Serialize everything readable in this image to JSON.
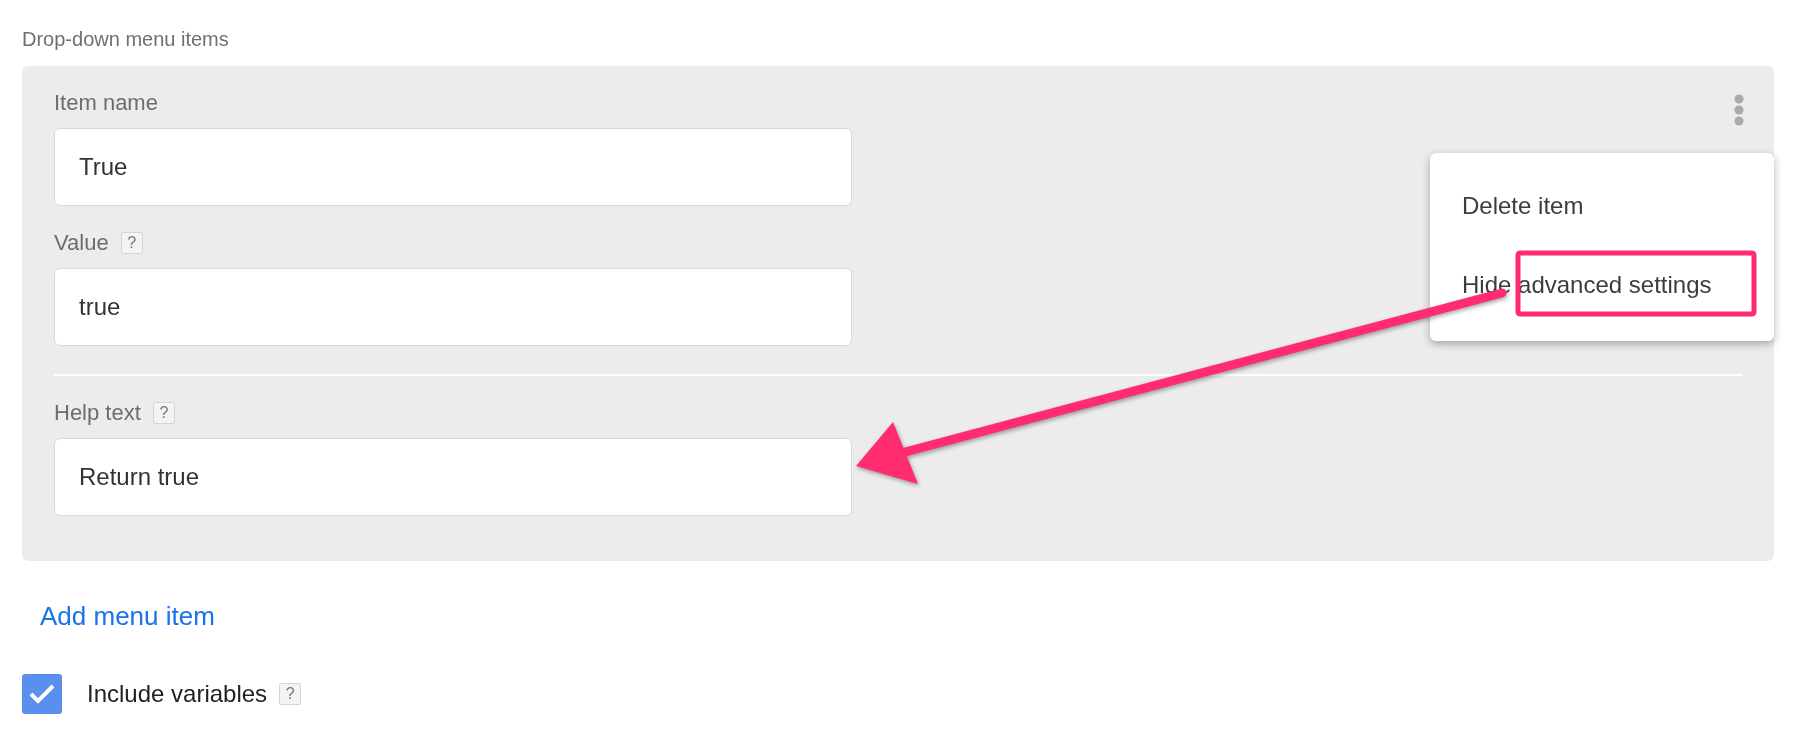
{
  "section_label": "Drop-down menu items",
  "menu_item": {
    "menu_open": true,
    "fields": [
      {
        "label": "Item name",
        "value": "True"
      },
      {
        "label": "Value",
        "help": "?",
        "value": "true"
      }
    ],
    "advanced_fields": [
      {
        "label": "Help text",
        "help": "?",
        "value": "Return true"
      }
    ],
    "menu": [
      "Delete item",
      "Hide advanced settings"
    ]
  },
  "add_link": "Add menu item",
  "include_variables": {
    "label": "Include variables",
    "help": "?",
    "checked": true
  },
  "highlight_box": true,
  "arrow": true
}
